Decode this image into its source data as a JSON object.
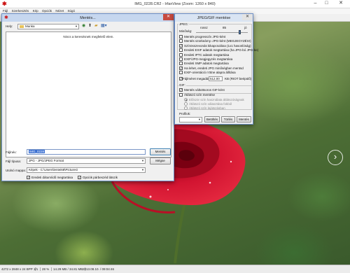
{
  "main": {
    "title": "IMG_0228.CR2 - IrfanView (Zoom: 1260 x 840)",
    "menu": [
      "Fájl",
      "Szerkesztés",
      "Kép",
      "Opciók",
      "Nézet",
      "Súgó"
    ],
    "nav_next_glyph": "›"
  },
  "status": {
    "dims": "4272 x 2848 x 24 BPP",
    "index": "1/1",
    "zoom": "28 %",
    "size": "14.29 MB / 34.81 MB",
    "datetime": "2013.08.10. / 09:04:46"
  },
  "save_dialog": {
    "title": "Mentés...",
    "location_label": "Hely:",
    "location_value": "Munka",
    "empty_message": "Nincs a keresésnek megfelelő elem.",
    "filename_label": "Fájlnév:",
    "filename_value": "IMG_0228",
    "filetype_label": "Fájl típusa:",
    "filetype_value": "JPG - JPG/JPEG Format",
    "lastfolder_label": "Utolsó mappa:",
    "lastfolder_value": "Képek  -  C:\\Users\\lentei68\\Pictures\\",
    "save_button": "Mentés",
    "cancel_button": "Mégse",
    "keep_date_label": "Eredeti dátum/idő megtartása",
    "show_options_label": "Opciók párbeszéd látszik",
    "keep_date_checked": "✓",
    "show_options_checked": "✓"
  },
  "jpeg_dialog": {
    "title": "JPEG/GIF mentése",
    "jpeg_group": "JPEG:",
    "quality_label": "Minőség:",
    "quality_low": "rossz",
    "quality_value": "85",
    "quality_high": "jó",
    "options": [
      {
        "label": "Mentés progresszív JPG-ként",
        "checked": ""
      },
      {
        "label": "Mentés szürkeárny.-JPG-ként (MEGJEGYZÉS!)",
        "checked": ""
      },
      {
        "label": "Színösszevonás kikapcsolása (1x1 hasonlóság)",
        "checked": "✓"
      },
      {
        "label": "Eredeti EXIF adatok megtartása (ha JPG-bó JPG-be)",
        "checked": ""
      },
      {
        "label": "Eredeti IPTC adatok megtartása",
        "checked": ""
      },
      {
        "label": "EXIF/JPG-megjegyzés megtartása",
        "checked": ""
      },
      {
        "label": "Eredeti XMP adatok megtartása",
        "checked": ""
      },
      {
        "label": "Ha lehet, eredeti JPG minőségben mentsd",
        "checked": "✓"
      },
      {
        "label": "EXIF-orientáció n'ötne alapra állítása",
        "checked": ""
      }
    ],
    "filesize_label": "Fájlméret megadása:",
    "filesize_value": "512.00",
    "filesize_unit": "KB (RIOT beépülő)",
    "gif_group": "GIF:",
    "gif_options": [
      {
        "label": "Mentés váltottsoros GIF-ként",
        "checked": "✓"
      },
      {
        "label": "Átlátszó szín mentése",
        "checked": ""
      }
    ],
    "radios": [
      {
        "label": "Először szín használata átlátszóságnak",
        "on": true
      },
      {
        "label": "Átlátszó szín választása fokból",
        "on": false
      },
      {
        "label": "Átlátszó szín lejátszásban",
        "on": false
      }
    ],
    "preset_label": "Profilok:",
    "load_button": "Betöltés",
    "delete_button": "Törlés",
    "save_button": "Mentés"
  },
  "colors": {
    "dialog_bg": "#f0f0f0",
    "dialog_title": "#c6d7ef",
    "close_red": "#c74a3f",
    "accent_blue": "#3a6fd1",
    "rose_red": "#c8102e"
  },
  "icons": [
    "irfanview-icon",
    "close-icon",
    "back-icon",
    "up-folder-icon",
    "new-folder-icon",
    "view-menu-icon",
    "next-image-icon",
    "dropdown-arrow-icon"
  ]
}
